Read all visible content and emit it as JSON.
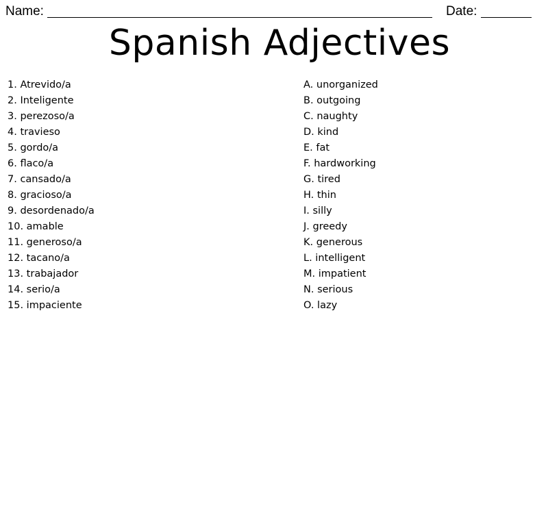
{
  "header": {
    "name_label": "Name:",
    "date_label": "Date:"
  },
  "title": "Spanish Adjectives",
  "terms": [
    "1. Atrevido/a",
    "2. Inteligente",
    "3. perezoso/a",
    "4. travieso",
    "5. gordo/a",
    "6. flaco/a",
    "7. cansado/a",
    "8. gracioso/a",
    "9. desordenado/a",
    "10. amable",
    "11. generoso/a",
    "12. tacano/a",
    "13. trabajador",
    "14. serio/a",
    "15. impaciente"
  ],
  "definitions": [
    "A. unorganized",
    "B. outgoing",
    "C. naughty",
    "D. kind",
    "E. fat",
    "F. hardworking",
    "G. tired",
    "H. thin",
    "I. silly",
    "J. greedy",
    "K. generous",
    "L. intelligent",
    "M. impatient",
    "N. serious",
    "O. lazy"
  ]
}
